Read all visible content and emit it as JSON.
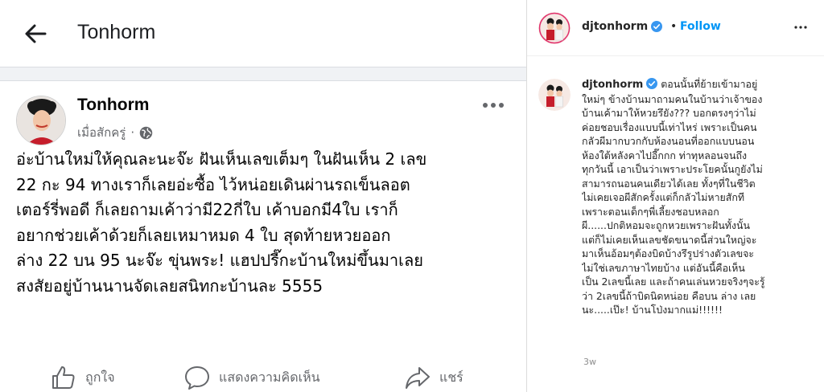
{
  "facebook": {
    "header_title": "Tonhorm",
    "post": {
      "author": "Tonhorm",
      "timestamp": "เมื่อสักครู่",
      "separator": "·",
      "body_lines": [
        "อ่ะบ้านใหม่ให้คุณละนะจ๊ะ ฝันเห็นเลขเต็มๆ ในฝันเห็น 2 เลข",
        "22 กะ 94 ทางเราก็เลยอ่ะซื้อ ไว้หน่อยเดินผ่านรถเข็นลอต",
        "เตอร์รี่พอดี ก็เลยถามเค้าว่ามี22กี่ใบ  เค้าบอกมี4ใบ เราก็",
        "อยากช่วยเค้าด้วยก็เลยเหมาหมด 4 ใบ สุดท้ายหวยออก",
        "ล่าง 22 บน 95 นะจ๊ะ ขุ่นพระ! แฮปปรี๊กะบ้านใหม่ขึ้นมาเลย",
        "สงสัยอยู่บ้านนานจัดเลยสนิทกะบ้านละ 5555"
      ]
    },
    "actions": {
      "like": "ถูกใจ",
      "comment": "แสดงความคิดเห็น",
      "share": "แชร์"
    },
    "icons": [
      "back-arrow-icon",
      "more-dots-icon",
      "globe-icon",
      "thumbs-up-icon",
      "comment-bubble-icon",
      "share-arrow-icon"
    ]
  },
  "instagram": {
    "username": "djtonhorm",
    "separator": "•",
    "follow_label": "Follow",
    "caption_user": "djtonhorm",
    "caption_lines": [
      "ตอนนั้นที่ย้ายเข้ามาอยู่",
      "ใหม่ๆ ข้างบ้านมาถามคนในบ้านว่าเจ้าของ",
      "บ้านเค้ามาให้หวยรึยัง??? บอกตรงๆว่าไม่",
      "ค่อยชอบเรื่องแบบนี้เท่าไหร่ เพราะเป็นคน",
      "กลัวผีมากบวกกับห้องนอนที่ออกแบบนอน",
      "ห้องใต้หลังคาไปอี๊กกก ท่าทุหลอนจนถึง",
      "ทุกวันนี้ เอาเป็นว่าเพราะประโยคนั้นกูยังไม่",
      "สามารถนอนคนเดียวได้เลย ทั้งๆที่ในชีวิต",
      "ไม่เคยเจอผีสักครั้งแต่ก็กลัวไม่หายสักที",
      "เพราะตอนเด็กๆพี่เลี้ยงชอบหลอก",
      "ผี......ปกติหอมจะถูกหวยเพราะฝันทั้งนั้น",
      "แต่ก็ไม่เคยเห็นเลขชัดขนาดนี้ส่วนใหญ่จะ",
      "มาเห็นอ้อมๆต้องบิดบ้างรึรูปร่างตัวเลขจะ",
      "ไม่ใช่เลขภาษาไทยบ้าง แต่อันนี้คือเห็น",
      "เป็น 2เลขนี้เลย และถ้าคนเล่นหวยจริงๆจะรู้",
      "ว่า 2เลขนี้ถ้าบิดนิดหน่อย คือบน ล่าง เลย",
      "นะ.....เป๊ะ! บ้านโป่งมากแม่!!!!!!"
    ],
    "time_ago": "3w",
    "colors": {
      "follow": "#0095f6",
      "verified": "#3897f0"
    },
    "icons": [
      "verified-badge-icon",
      "more-dots-icon"
    ]
  }
}
